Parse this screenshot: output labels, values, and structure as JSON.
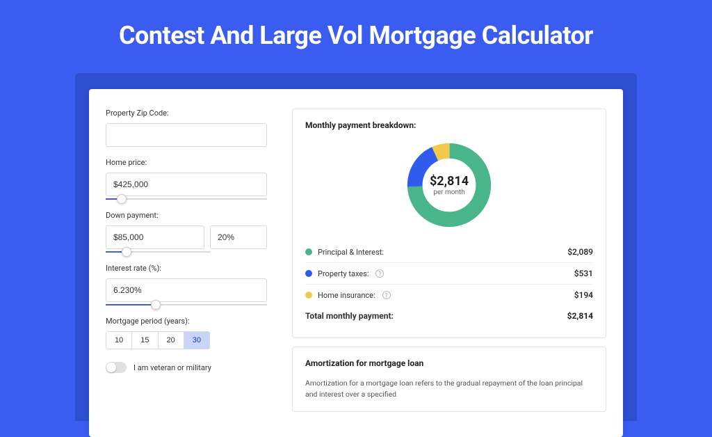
{
  "colors": {
    "green": "#49b58a",
    "blue": "#2f5ced",
    "yellow": "#f1c94e"
  },
  "page_title": "Contest And Large Vol Mortgage Calculator",
  "form": {
    "zip_label": "Property Zip Code:",
    "zip_value": "",
    "home_price_label": "Home price:",
    "home_price_value": "$425,000",
    "home_price_slider_pct": 10,
    "down_payment_label": "Down payment:",
    "down_payment_value": "$85,000",
    "down_payment_pct": "20%",
    "down_payment_slider_pct": 20,
    "interest_label": "Interest rate (%):",
    "interest_value": "6.230%",
    "interest_slider_pct": 31,
    "period_label": "Mortgage period (years):",
    "period_options": [
      "10",
      "15",
      "20",
      "30"
    ],
    "period_selected": "30",
    "veteran_label": "I am veteran or military",
    "veteran_on": false
  },
  "breakdown": {
    "title": "Monthly payment breakdown:",
    "center_amount": "$2,814",
    "center_sub": "per month",
    "items": [
      {
        "label": "Principal & Interest:",
        "value": "$2,089",
        "color": "#49b58a",
        "info": false
      },
      {
        "label": "Property taxes:",
        "value": "$531",
        "color": "#2f5ced",
        "info": true
      },
      {
        "label": "Home insurance:",
        "value": "$194",
        "color": "#f1c94e",
        "info": true
      }
    ],
    "total_label": "Total monthly payment:",
    "total_value": "$2,814"
  },
  "amortization": {
    "title": "Amortization for mortgage loan",
    "text": "Amortization for a mortgage loan refers to the gradual repayment of the loan principal and interest over a specified"
  },
  "chart_data": {
    "type": "pie",
    "title": "Monthly payment breakdown",
    "series": [
      {
        "name": "Principal & Interest",
        "value": 2089,
        "color": "#49b58a"
      },
      {
        "name": "Property taxes",
        "value": 531,
        "color": "#2f5ced"
      },
      {
        "name": "Home insurance",
        "value": 194,
        "color": "#f1c94e"
      }
    ],
    "total": 2814,
    "unit": "USD per month"
  }
}
